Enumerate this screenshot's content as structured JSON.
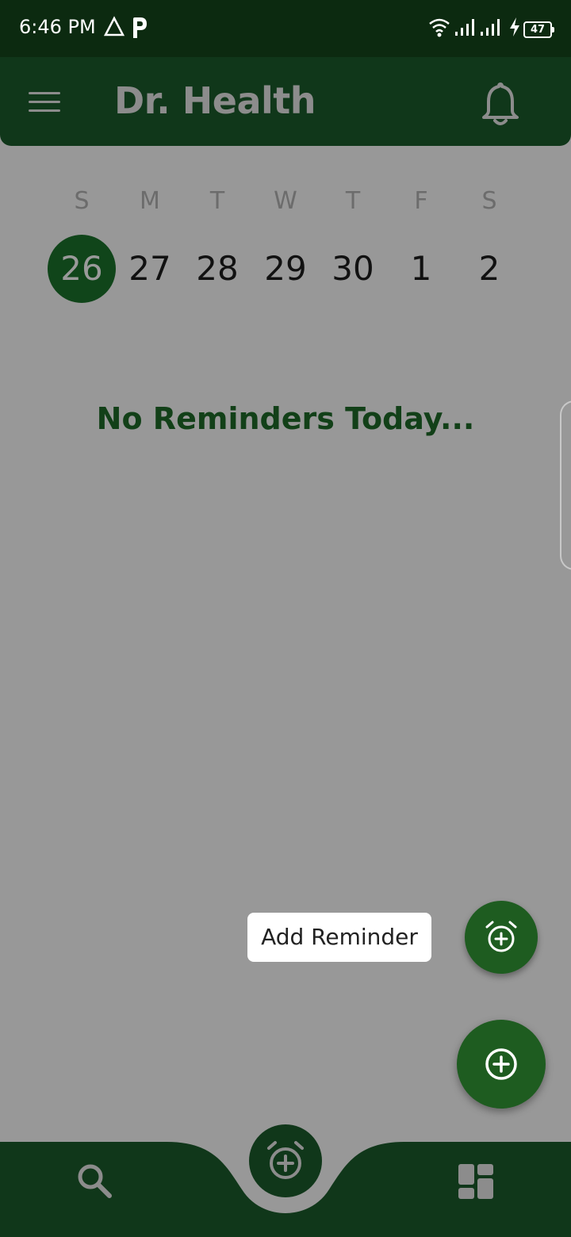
{
  "status_bar": {
    "time": "6:46 PM",
    "battery": "47",
    "icons": [
      "triangle-app-icon",
      "p-app-icon",
      "wifi-icon",
      "signal-icon",
      "signal-icon",
      "charging-icon"
    ]
  },
  "app_bar": {
    "title": "Dr. Health",
    "menu_icon": "menu-icon",
    "notification_icon": "bell-icon"
  },
  "calendar": {
    "days": [
      {
        "letter": "S",
        "date": "26",
        "selected": true
      },
      {
        "letter": "M",
        "date": "27"
      },
      {
        "letter": "T",
        "date": "28"
      },
      {
        "letter": "W",
        "date": "29"
      },
      {
        "letter": "T",
        "date": "30"
      },
      {
        "letter": "F",
        "date": "1"
      },
      {
        "letter": "S",
        "date": "2"
      }
    ]
  },
  "main": {
    "empty_message": "No Reminders Today..."
  },
  "fab": {
    "tooltip": "Add Reminder",
    "small_icon": "alarm-add-icon",
    "main_icon": "add-circle-icon"
  },
  "bottom_nav": {
    "items": [
      "search-icon",
      "alarm-add-icon",
      "dashboard-icon"
    ]
  },
  "colors": {
    "dark_green": "#10371a",
    "fab_green": "#1e5c20",
    "text_green": "#124018",
    "background": "#989898"
  }
}
